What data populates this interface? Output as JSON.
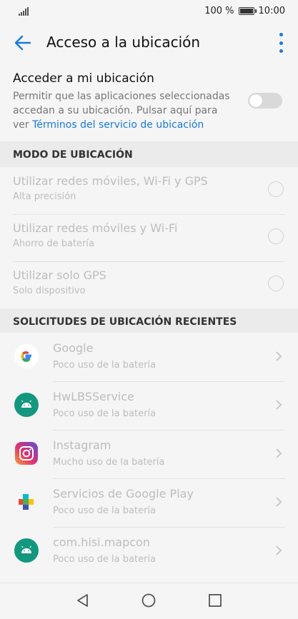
{
  "status": {
    "battery_text": "100 %",
    "time": "10:00",
    "battery_level": 1.0
  },
  "appbar": {
    "title": "Acceso a la ubicación"
  },
  "location_toggle": {
    "title": "Acceder a mi ubicación",
    "description": "Permitir que las aplicaciones seleccionadas accedan a su ubicación. Pulsar aquí para ver ",
    "link": "Términos del servicio de ubicación",
    "enabled": false
  },
  "mode_section": {
    "header": "MODO DE UBICACIÓN",
    "items": [
      {
        "title": "Utilizar redes móviles, Wi-Fi y GPS",
        "subtitle": "Alta precisión"
      },
      {
        "title": "Utilizar redes móviles y Wi-Fi",
        "subtitle": "Ahorro de batería"
      },
      {
        "title": "Utilizar solo GPS",
        "subtitle": "Solo dispositivo"
      }
    ]
  },
  "recent_section": {
    "header": "SOLICITUDES DE UBICACIÓN RECIENTES",
    "items": [
      {
        "name": "Google",
        "usage": "Poco uso de la batería",
        "icon": "google-icon"
      },
      {
        "name": "HwLBSService",
        "usage": "Poco uso de la batería",
        "icon": "android-icon"
      },
      {
        "name": "Instagram",
        "usage": "Mucho uso de la batería",
        "icon": "instagram-icon"
      },
      {
        "name": "Servicios de Google Play",
        "usage": "Poco uso de la batería",
        "icon": "play-services-icon"
      },
      {
        "name": "com.hisi.mapcon",
        "usage": "Poco uso de la batería",
        "icon": "android-icon"
      }
    ]
  },
  "colors": {
    "accent": "#1a7ad9",
    "android_green": "#14977f"
  }
}
